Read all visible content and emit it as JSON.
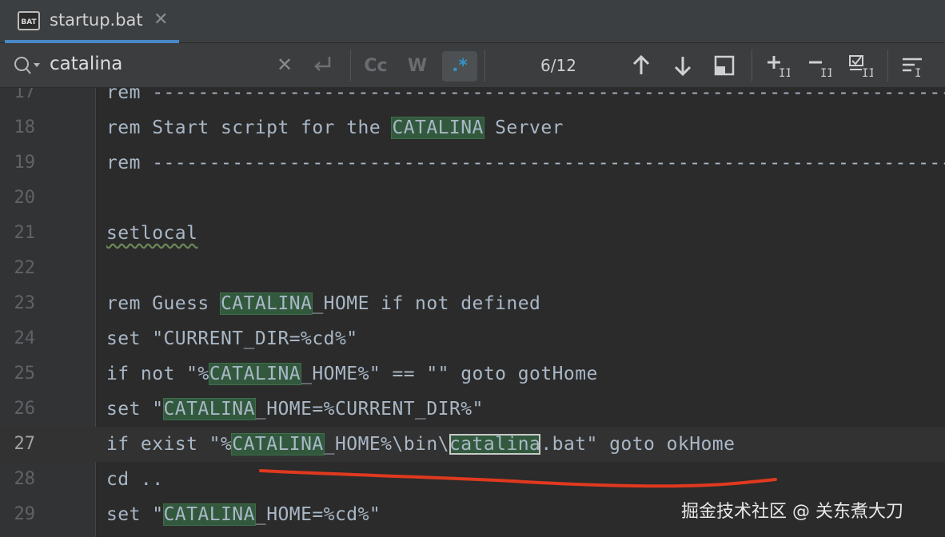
{
  "tab": {
    "title": "startup.bat",
    "icon_label": "BAT"
  },
  "find": {
    "query": "catalina",
    "match_case_label": "Cc",
    "words_label": "W",
    "regex_label": ".*",
    "count": "6/12"
  },
  "editor": {
    "lines": [
      {
        "num": "17",
        "parts": [
          {
            "t": "rem --------------------------------------------------------------------------"
          }
        ]
      },
      {
        "num": "18",
        "parts": [
          {
            "t": "rem Start script for the "
          },
          {
            "t": "CATALINA",
            "m": "hl"
          },
          {
            "t": " Server"
          }
        ]
      },
      {
        "num": "19",
        "parts": [
          {
            "t": "rem --------------------------------------------------------------------------"
          }
        ]
      },
      {
        "num": "20",
        "parts": [
          {
            "t": ""
          }
        ]
      },
      {
        "num": "21",
        "parts": [
          {
            "t": "setlocal",
            "m": "squiggle"
          }
        ]
      },
      {
        "num": "22",
        "parts": [
          {
            "t": ""
          }
        ]
      },
      {
        "num": "23",
        "parts": [
          {
            "t": "rem Guess "
          },
          {
            "t": "CATALINA",
            "m": "hl"
          },
          {
            "t": "_HOME if not defined"
          }
        ]
      },
      {
        "num": "24",
        "parts": [
          {
            "t": "set \"CURRENT_DIR=%cd%\""
          }
        ]
      },
      {
        "num": "25",
        "parts": [
          {
            "t": "if not \"%"
          },
          {
            "t": "CATALINA",
            "m": "hl"
          },
          {
            "t": "_HOME%\" == \"\" goto gotHome"
          }
        ]
      },
      {
        "num": "26",
        "parts": [
          {
            "t": "set \""
          },
          {
            "t": "CATALINA",
            "m": "hl"
          },
          {
            "t": "_HOME=%CURRENT_DIR%\""
          }
        ]
      },
      {
        "num": "27",
        "current": true,
        "parts": [
          {
            "t": "if exist \"%"
          },
          {
            "t": "CATALINA",
            "m": "hl"
          },
          {
            "t": "_HOME%\\bin\\"
          },
          {
            "t": "catalina",
            "m": "hl-cur"
          },
          {
            "t": ".bat\" goto okHome"
          }
        ]
      },
      {
        "num": "28",
        "parts": [
          {
            "t": "cd .."
          }
        ]
      },
      {
        "num": "29",
        "parts": [
          {
            "t": "set \""
          },
          {
            "t": "CATALINA",
            "m": "hl"
          },
          {
            "t": "_HOME=%cd%\""
          }
        ]
      }
    ]
  },
  "watermark": "掘金技术社区 @ 关东煮大刀",
  "colors": {
    "match_bg": "#32593d",
    "annotation": "#e0391f",
    "accent": "#4a88c7"
  }
}
